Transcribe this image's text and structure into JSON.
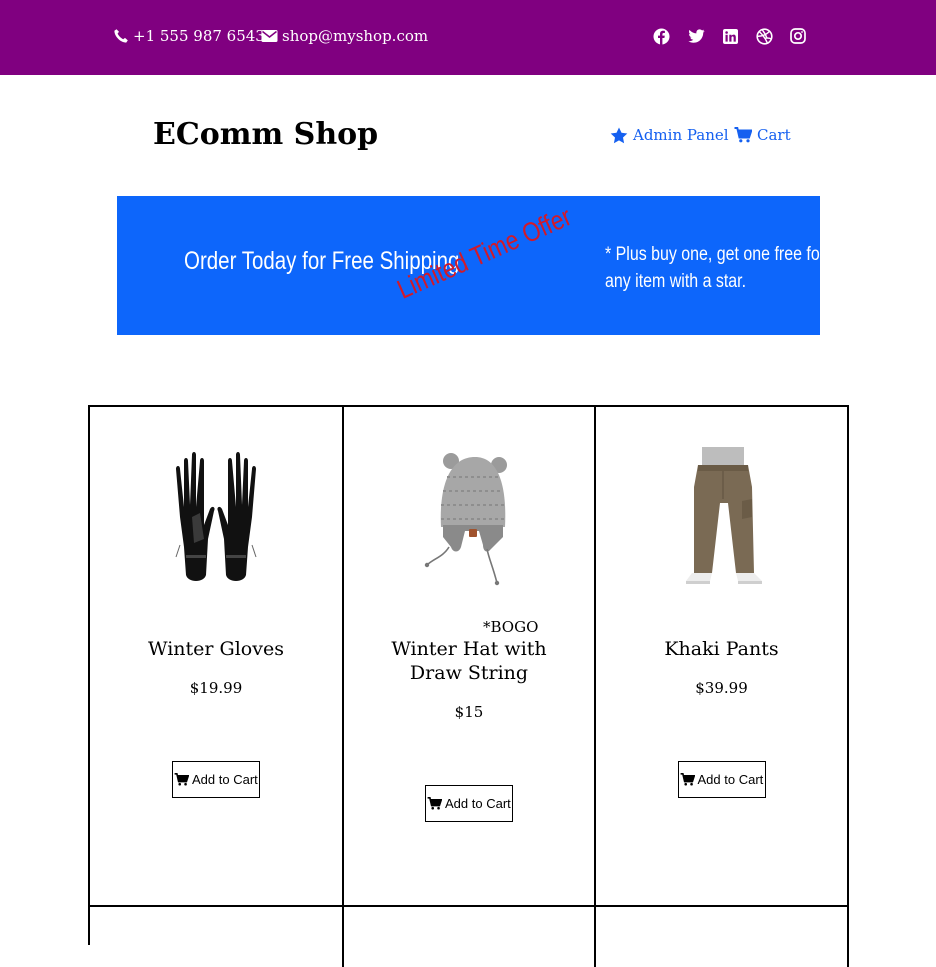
{
  "topbar": {
    "phone": "+1 555 987 6543",
    "email": "shop@myshop.com",
    "social_icons": [
      "facebook-icon",
      "twitter-icon",
      "linkedin-icon",
      "dribbble-icon",
      "instagram-icon"
    ]
  },
  "header": {
    "brand": "EComm Shop",
    "admin_label": "Admin Panel",
    "cart_label": "Cart"
  },
  "banner": {
    "main_text": "Order Today for Free Shipping",
    "offer_text": "Limited Time Offer",
    "note_line1": "* Plus buy one, get one free for",
    "note_line2": "any item with a star."
  },
  "products": [
    {
      "name": "Winter Gloves",
      "price": "$19.99",
      "badge": "",
      "button_label": "Add to Cart"
    },
    {
      "name_line1": "Winter Hat with",
      "name_line2": "Draw String",
      "price": "$15",
      "badge": "*BOGO",
      "button_label": "Add to Cart"
    },
    {
      "name": "Khaki Pants",
      "price": "$39.99",
      "badge": "",
      "button_label": "Add to Cart"
    }
  ],
  "colors": {
    "topbar_bg": "#800080",
    "link": "#1560f0",
    "banner_bg": "#0d66fb",
    "banner_offer": "#d11a2a"
  }
}
